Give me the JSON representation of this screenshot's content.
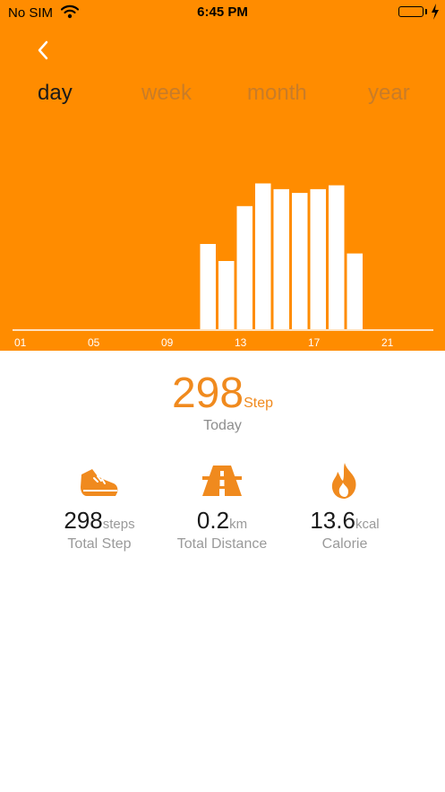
{
  "colors": {
    "header_bg": "#FF8C00",
    "accent": "#F08A1E",
    "bar": "#FFFFFF"
  },
  "status_bar": {
    "carrier": "No SIM",
    "time": "6:45 PM"
  },
  "nav": {
    "back_icon": "chevron-left-icon"
  },
  "tabs": [
    {
      "label": "day",
      "active": true
    },
    {
      "label": "week",
      "active": false
    },
    {
      "label": "month",
      "active": false
    },
    {
      "label": "year",
      "active": false
    }
  ],
  "chart_data": {
    "type": "bar",
    "x_tick_labels": [
      "01",
      "05",
      "09",
      "13",
      "17",
      "21"
    ],
    "categories": [
      "01",
      "02",
      "03",
      "04",
      "05",
      "06",
      "07",
      "08",
      "09",
      "10",
      "11",
      "12",
      "13",
      "14",
      "15",
      "16",
      "17",
      "18",
      "19",
      "20",
      "21",
      "22",
      "23",
      "24"
    ],
    "values": [
      0,
      0,
      0,
      0,
      0,
      0,
      0,
      0,
      0,
      0,
      0.45,
      0.36,
      0.65,
      0.77,
      0.74,
      0.72,
      0.74,
      0.76,
      0.4,
      0,
      0,
      0,
      0,
      0
    ],
    "ylim": [
      0,
      1
    ],
    "grid": false,
    "legend": "none"
  },
  "summary": {
    "value": "298",
    "unit": "Step",
    "label": "Today"
  },
  "stats": [
    {
      "icon": "shoe-icon",
      "value": "298",
      "unit": "steps",
      "label": "Total Step"
    },
    {
      "icon": "road-icon",
      "value": "0.2",
      "unit": "km",
      "label": "Total Distance"
    },
    {
      "icon": "flame-icon",
      "value": "13.6",
      "unit": "kcal",
      "label": "Calorie"
    }
  ]
}
